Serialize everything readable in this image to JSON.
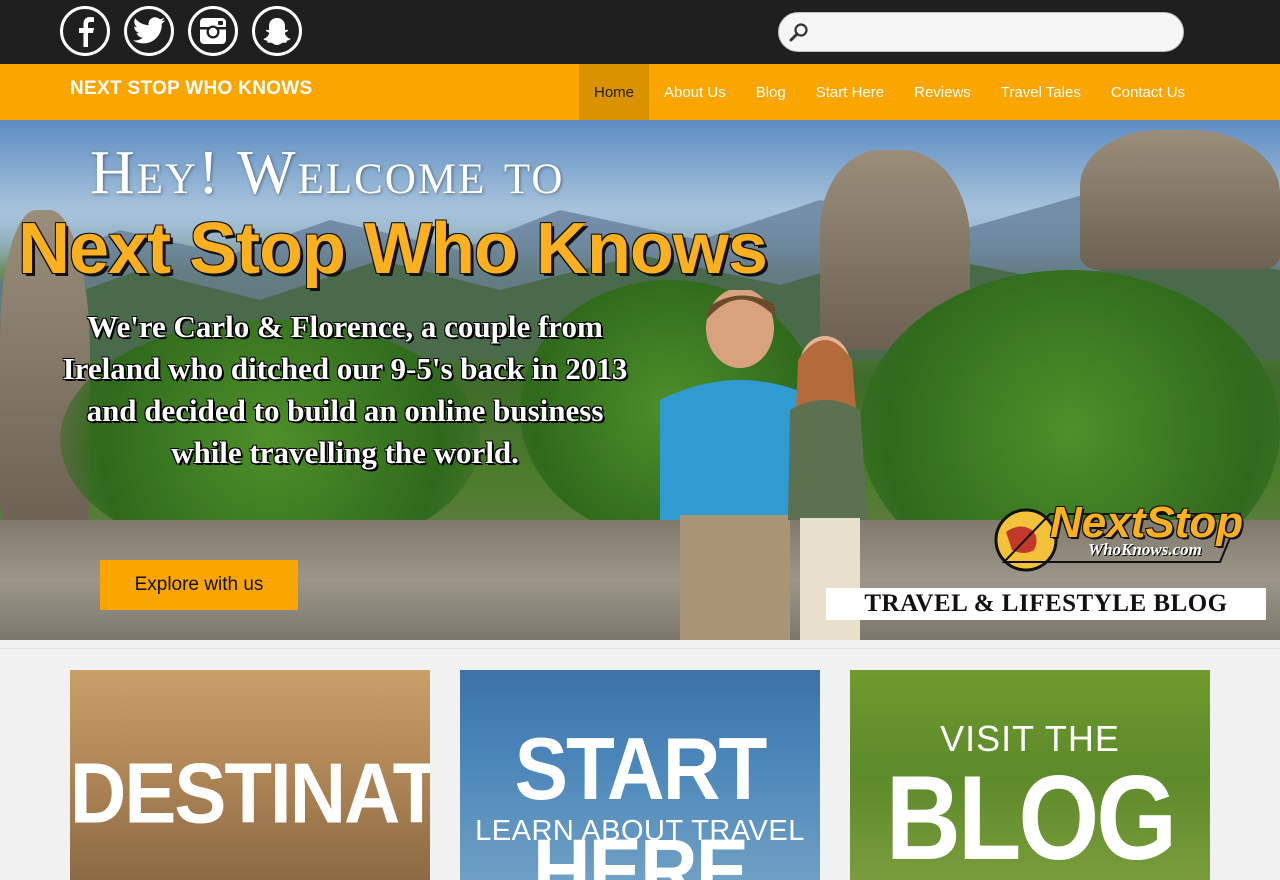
{
  "social": {
    "icons": [
      "facebook-icon",
      "twitter-icon",
      "instagram-icon",
      "snapchat-icon"
    ]
  },
  "search": {
    "placeholder": "",
    "value": ""
  },
  "nav": {
    "brand": "NEXT STOP WHO KNOWS",
    "items": [
      "Home",
      "About Us",
      "Blog",
      "Start Here",
      "Reviews",
      "Travel Tales",
      "Contact Us"
    ],
    "active": "Home"
  },
  "hero": {
    "welcome": "Hey! Welcome to",
    "title": "Next Stop Who Knows",
    "intro_lines": [
      "We're Carlo & Florence, a couple from",
      "Ireland who ditched our 9-5's back in 2013",
      "and decided to build an online business",
      "while travelling the world."
    ],
    "logo_main": "NextStop",
    "logo_sub": "WhoKnows.com",
    "tagline": "TRAVEL & LIFESTYLE BLOG",
    "cta": "Explore with us"
  },
  "cards": {
    "destinations": "DESTINATIONS",
    "start_title": "START HERE",
    "start_sub": "LEARN ABOUT TRAVEL",
    "blog_pre": "VISIT THE",
    "blog_title": "BLOG"
  },
  "colors": {
    "accent": "#fba500",
    "topbar": "#1f1f1f",
    "active_nav": "#d99200"
  }
}
